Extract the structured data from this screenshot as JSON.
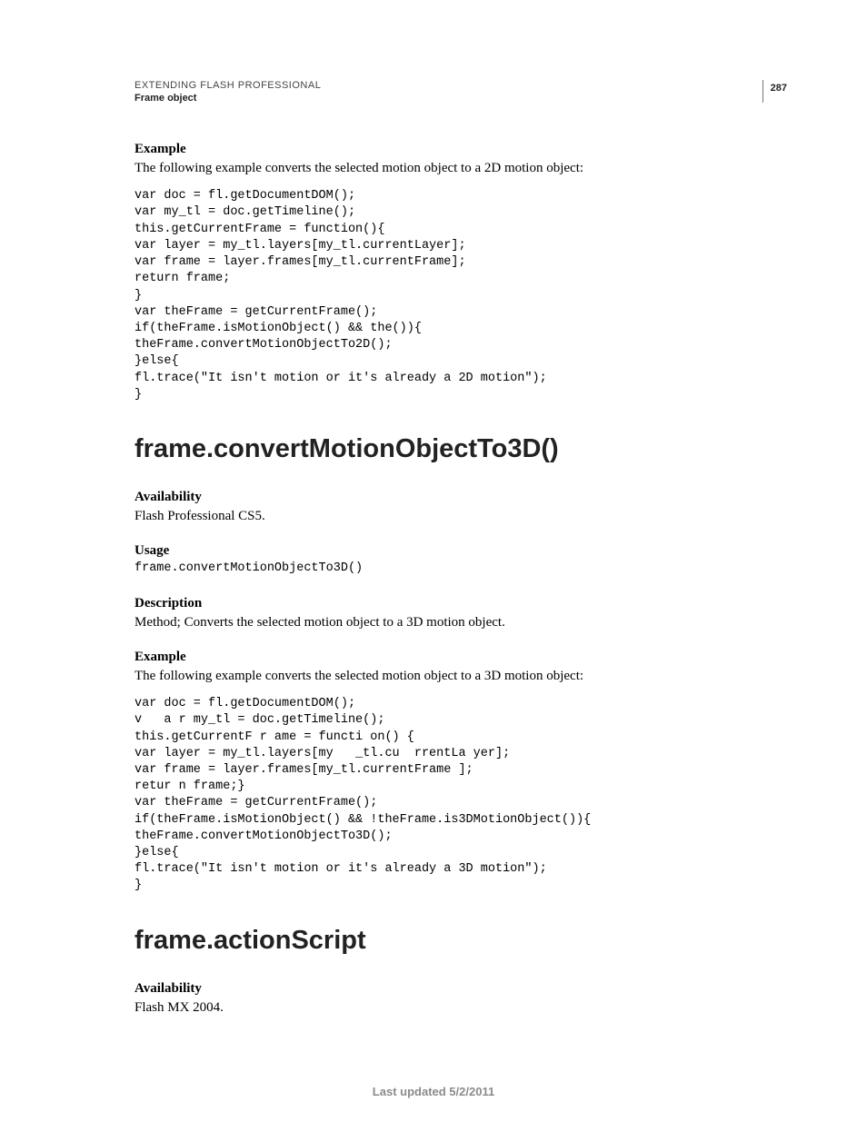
{
  "header": {
    "line1": "EXTENDING FLASH PROFESSIONAL",
    "line2": "Frame object",
    "page_number": "287"
  },
  "section1": {
    "example_head": "Example",
    "example_intro": "The following example converts the selected motion object to a 2D motion object:",
    "code": "var doc = fl.getDocumentDOM();\nvar my_tl = doc.getTimeline();\nthis.getCurrentFrame = function(){\nvar layer = my_tl.layers[my_tl.currentLayer];\nvar frame = layer.frames[my_tl.currentFrame];\nreturn frame;\n}\nvar theFrame = getCurrentFrame();\nif(theFrame.isMotionObject() && the()){\ntheFrame.convertMotionObjectTo2D();\n}else{\nfl.trace(\"It isn't motion or it's already a 2D motion\");\n}"
  },
  "section2": {
    "title": "frame.convertMotionObjectTo3D()",
    "availability_head": "Availability",
    "availability_text": "Flash Professional CS5.",
    "usage_head": "Usage",
    "usage_code": "frame.convertMotionObjectTo3D()",
    "description_head": "Description",
    "description_text": "Method; Converts the selected motion object to a 3D motion object.",
    "example_head": "Example",
    "example_intro": "The following example converts the selected motion object to a 3D motion object:",
    "code": "var doc = fl.getDocumentDOM();\nv   a r my_tl = doc.getTimeline();\nthis.getCurrentF r ame = functi on() {\nvar layer = my_tl.layers[my   _tl.cu  rrentLa yer];\nvar frame = layer.frames[my_tl.currentFrame ];\nretur n frame;}\nvar theFrame = getCurrentFrame();\nif(theFrame.isMotionObject() && !theFrame.is3DMotionObject()){\ntheFrame.convertMotionObjectTo3D();\n}else{\nfl.trace(\"It isn't motion or it's already a 3D motion\");\n}"
  },
  "section3": {
    "title": "frame.actionScript",
    "availability_head": "Availability",
    "availability_text": "Flash MX 2004."
  },
  "footer": "Last updated 5/2/2011"
}
